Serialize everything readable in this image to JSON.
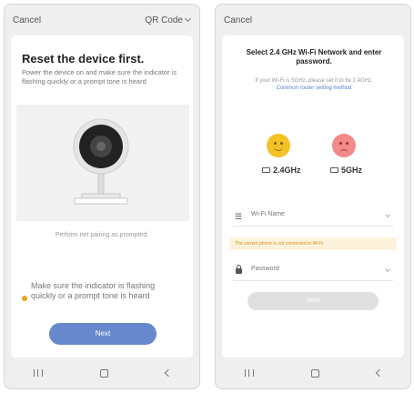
{
  "left": {
    "cancel_label": "Cancel",
    "qr_label": "QR Code",
    "title": "Reset the device first.",
    "description": "Power the device on and make sure the indicator is flashing quickly or a prompt tone is heard",
    "perform_text": "Perform net pairing as prompted.",
    "hint_text": "Make sure the indicator is flashing quickly or a prompt tone is heard",
    "next_label": "Next",
    "icons": [
      "chevron-down-icon",
      "camera-illustration",
      "warning-dot-icon",
      "recents-icon",
      "home-icon",
      "back-icon"
    ],
    "colors": {
      "accent": "#6788cc",
      "warning": "#f0a020"
    }
  },
  "right": {
    "cancel_label": "Cancel",
    "title": "Select 2.4 GHz Wi-Fi Network and enter password.",
    "subtitle": "If your Wi-Fi is 5GHz, please set it to be 2.4GHz.",
    "link_text": "Common router setting method",
    "band_24": "2.4GHz",
    "band_5": "5GHz",
    "wifi_placeholder": "Wi-Fi Name",
    "warning_text": "The current phone is not connected to Wi-Fi",
    "password_placeholder": "Password",
    "next_label": "Next",
    "icons": [
      "happy-face-icon",
      "sad-face-icon",
      "router-icon",
      "wifi-icon",
      "lock-icon",
      "chevron-down-icon"
    ],
    "colors": {
      "happy": "#f3c325",
      "sad": "#f28a8a",
      "link": "#5a7fd0",
      "warning_bg": "#fdf3dc"
    }
  }
}
